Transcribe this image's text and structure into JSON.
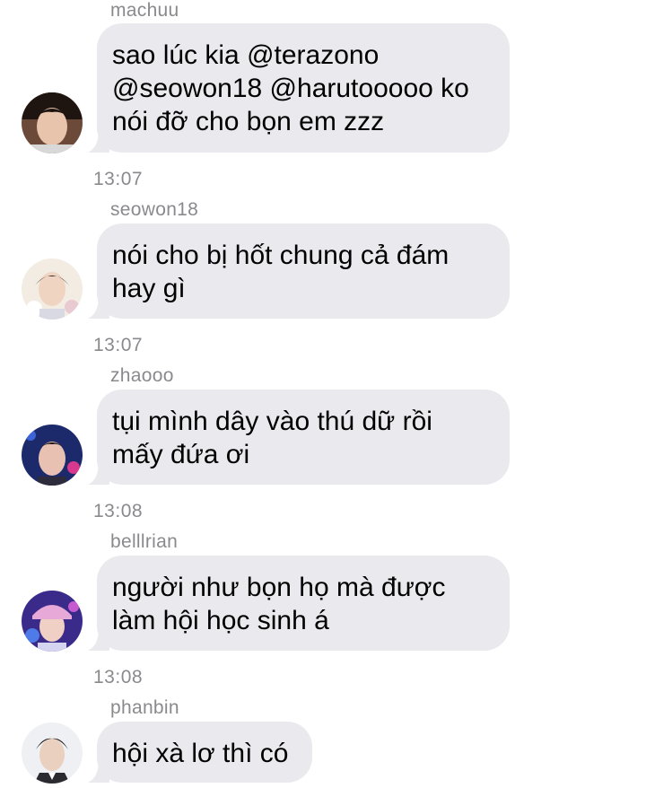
{
  "messages": [
    {
      "sender": "machuu",
      "lines": [
        "sao lúc kia @terazono",
        "@seowon18 @harutooooo ko",
        "nói đỡ cho bọn em zzz"
      ],
      "time": "13:07"
    },
    {
      "sender": "seowon18",
      "lines": [
        "nói cho bị hốt chung cả đám",
        "hay gì"
      ],
      "time": "13:07"
    },
    {
      "sender": "zhaooo",
      "lines": [
        "tụi mình dây vào thú dữ rồi",
        "mấy đứa ơi"
      ],
      "time": "13:08"
    },
    {
      "sender": "belllrian",
      "lines": [
        "người như bọn họ mà được",
        "làm hội học sinh á"
      ],
      "time": "13:08"
    },
    {
      "sender": "phanbin",
      "lines": [
        "hội xà lơ thì có"
      ],
      "time": ""
    }
  ],
  "colors": {
    "bubble": "#e9e9ee",
    "meta_text": "#8a8a8e",
    "text": "#000000"
  }
}
